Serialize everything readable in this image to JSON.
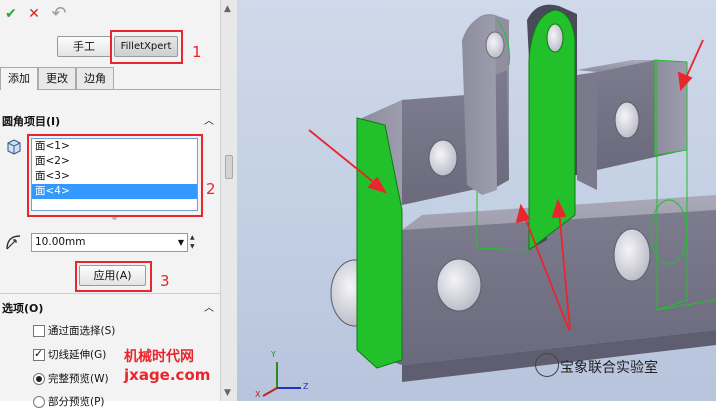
{
  "toolbar": {
    "ok_icon": "✔",
    "cancel_icon": "✕",
    "undo_icon": "↶"
  },
  "mode_buttons": {
    "manual": "手工",
    "filletxpert": "FilletXpert"
  },
  "tabs": [
    {
      "label": "添加"
    },
    {
      "label": "更改"
    },
    {
      "label": "边角"
    }
  ],
  "sections": {
    "fillet_items": "圆角项目(I)",
    "options": "选项(O)"
  },
  "face_list": [
    "面<1>",
    "面<2>",
    "面<3>",
    "面<4>"
  ],
  "selected_face_index": 3,
  "radius": {
    "value": "10.00mm"
  },
  "apply_button": "应用(A)",
  "options": [
    {
      "type": "checkbox",
      "label": "通过面选择(S)",
      "checked": false
    },
    {
      "type": "checkbox",
      "label": "切线延伸(G)",
      "checked": true
    },
    {
      "type": "radio",
      "label": "完整预览(W)",
      "checked": true
    },
    {
      "type": "radio",
      "label": "部分预览(P)",
      "checked": false
    }
  ],
  "callouts": [
    "1",
    "2",
    "3"
  ],
  "watermark": {
    "site_name": "机械时代网",
    "url": "jxage.com"
  },
  "brand": {
    "text": "宝象联合实验室"
  },
  "axes": {
    "x": "X",
    "y": "Y",
    "z": "Z"
  },
  "colors": {
    "accent_red": "#e8262d",
    "selection_blue": "#3399ff",
    "fillet_green": "#22c02a",
    "part_gray": "#7d7d8f"
  }
}
